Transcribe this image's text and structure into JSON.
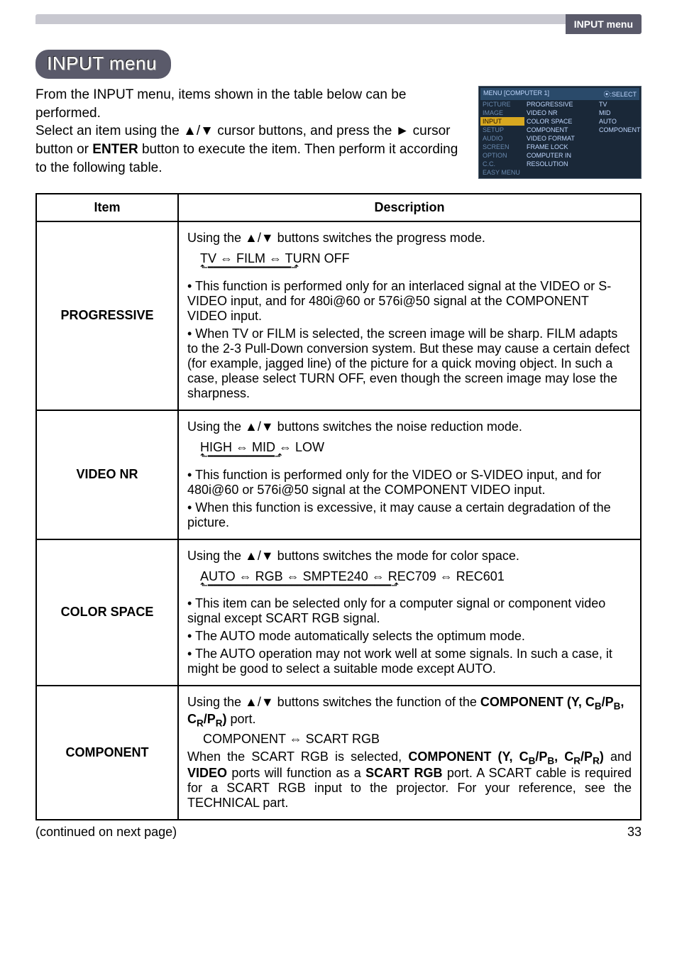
{
  "header": {
    "tab_label": "INPUT menu"
  },
  "heading": "INPUT menu",
  "intro": {
    "p1a": "From the INPUT menu, items shown in the table below can be performed.",
    "p1b": "Select an item using the ▲/▼ cursor buttons, and press the ► cursor button or ",
    "enter": "ENTER",
    "p1c": " button to execute the item. Then perform it according to the following table."
  },
  "osd": {
    "title_left": "MENU [COMPUTER 1]",
    "title_right": "⦿:SELECT",
    "left": [
      "PICTURE",
      "IMAGE",
      "INPUT",
      "SETUP",
      "AUDIO",
      "SCREEN",
      "OPTION",
      "C.C.",
      "EASY MENU"
    ],
    "selected_index": 2,
    "mid": [
      "PROGRESSIVE",
      "VIDEO NR",
      "COLOR SPACE",
      "COMPONENT",
      "VIDEO FORMAT",
      "FRAME LOCK",
      "COMPUTER IN",
      "RESOLUTION"
    ],
    "right": [
      "TV",
      "MID",
      "AUTO",
      "COMPONENT",
      "",
      "",
      "",
      ""
    ]
  },
  "table": {
    "headers": {
      "item": "Item",
      "desc": "Description"
    },
    "rows": [
      {
        "item": "PROGRESSIVE",
        "lead": "Using the ▲/▼ buttons switches the progress mode.",
        "cycle": "TV ⇔ FILM ⇔ TURN OFF",
        "bullets": [
          "• This function is performed only for an interlaced signal at the VIDEO or S-VIDEO input, and for 480i@60 or 576i@50 signal at the COMPONENT VIDEO input.",
          "• When TV or FILM is selected, the screen image will be sharp. FILM adapts to the 2-3 Pull-Down conversion system. But these may cause a certain defect (for example, jagged line) of the picture for a quick moving object. In such a case, please select TURN OFF, even though the screen image may lose the sharpness."
        ]
      },
      {
        "item": "VIDEO NR",
        "lead": "Using the ▲/▼ buttons switches the noise reduction mode.",
        "cycle": "HIGH ⇔ MID ⇔ LOW",
        "bullets": [
          "• This function is performed only for the VIDEO or S-VIDEO input, and for 480i@60 or 576i@50 signal at the COMPONENT VIDEO input.",
          "• When this function is excessive, it may cause a certain degradation of the picture."
        ]
      },
      {
        "item": "COLOR SPACE",
        "lead": "Using the ▲/▼ buttons switches the mode for color space.",
        "cycle": "AUTO ⇔ RGB ⇔ SMPTE240 ⇔ REC709 ⇔ REC601",
        "bullets": [
          "• This item can be selected only for a computer signal or component video signal except SCART RGB signal.",
          "• The AUTO mode automatically selects the optimum mode.",
          "• The AUTO operation may not work well at some signals. In such a case, it might be good to select a suitable mode except AUTO."
        ]
      },
      {
        "item": "COMPONENT",
        "lead_pre": "Using the ▲/▼ buttons switches the function of the ",
        "lead_bold": "COMPONENT (Y, C",
        "lead_sub1": "B",
        "lead_mid1": "/P",
        "lead_sub2": "B",
        "lead_mid2": ", C",
        "lead_sub3": "R",
        "lead_mid3": "/P",
        "lead_sub4": "R",
        "lead_post": ")",
        "lead_tail": " port.",
        "cycle": "COMPONENT ⇔ SCART RGB",
        "tail_a": "When the SCART RGB is selected, ",
        "tail_bold1": "COMPONENT (Y, C",
        "tail_sub1": "B",
        "tail_m1": "/P",
        "tail_sub2": "B",
        "tail_m2": ", C",
        "tail_sub3": "R",
        "tail_m3": "/P",
        "tail_sub4": "R",
        "tail_bold1_end": ")",
        "tail_b": " and ",
        "tail_bold2": "VIDEO",
        "tail_c": " ports will function as a ",
        "tail_bold3": "SCART RGB",
        "tail_d": " port. A SCART cable is required for a SCART RGB input to the projector. For your reference, see the TECHNICAL part."
      }
    ]
  },
  "footer": {
    "continued": "(continued on next page)",
    "page": "33"
  }
}
